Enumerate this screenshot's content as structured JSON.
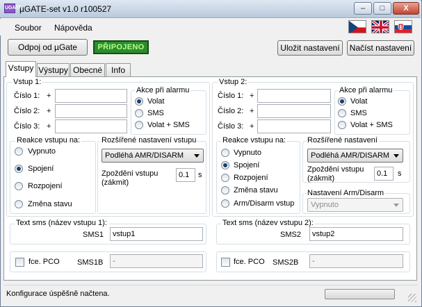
{
  "window": {
    "title": "µGATE-set v1.0 r100527",
    "min": "–",
    "max": "□",
    "close": "X",
    "app_icon": "UGATE"
  },
  "menu": [
    "Soubor",
    "Nápověda"
  ],
  "flags": [
    "cz-flag-icon",
    "uk-flag-icon",
    "sk-flag-icon"
  ],
  "toolbar": {
    "disconnect": "Odpoj od µGate",
    "status": "PŘIPOJENO",
    "save": "Uložit nastavení",
    "load": "Načíst nastavení"
  },
  "tabs": [
    "Vstupy",
    "Výstupy",
    "Obecné",
    "Info"
  ],
  "colors": {
    "status_bg": "#2c8c2c",
    "status_text": "#b6ff8c"
  },
  "input1": {
    "title": "Vstup 1:",
    "numbers": [
      {
        "label": "Číslo 1:",
        "plus": "+",
        "value": ""
      },
      {
        "label": "Číslo 2:",
        "plus": "+",
        "value": ""
      },
      {
        "label": "Číslo 3:",
        "plus": "+",
        "value": ""
      }
    ],
    "alarm": {
      "title": "Akce při alarmu",
      "options": [
        "Volat",
        "SMS",
        "Volat + SMS"
      ],
      "selected": 0
    },
    "reaction": {
      "title": "Reakce vstupu na:",
      "options": [
        "Vypnuto",
        "Spojení",
        "Rozpojení",
        "Změna stavu"
      ],
      "selected": 1
    },
    "extended": {
      "title": "Rozšířené nastavení vstupu",
      "mode": "Podléhá AMR/DISARM",
      "delay_label": "Zpoždění vstupu",
      "delay_sub": "(zákmit)",
      "delay_value": "0.1",
      "delay_unit": "s"
    },
    "sms": {
      "title": "Text sms (název vstupu 1):",
      "label": "SMS1",
      "value": "vstup1"
    },
    "pco": {
      "label": "fce. PCO",
      "checked": false,
      "sms_label": "SMS1B",
      "value": "-"
    }
  },
  "input2": {
    "title": "Vstup 2:",
    "numbers": [
      {
        "label": "Číslo 1:",
        "plus": "+",
        "value": ""
      },
      {
        "label": "Číslo 2:",
        "plus": "+",
        "value": ""
      },
      {
        "label": "Číslo 3:",
        "plus": "+",
        "value": ""
      }
    ],
    "alarm": {
      "title": "Akce při alarmu",
      "options": [
        "Volat",
        "SMS",
        "Volat + SMS"
      ],
      "selected": 0
    },
    "reaction": {
      "title": "Reakce vstupu na:",
      "options": [
        "Vypnuto",
        "Spojení",
        "Rozpojení",
        "Změna stavu",
        "Arm/Disarm vstup"
      ],
      "selected": 1
    },
    "extended": {
      "title": "Rozšířené nastavení",
      "mode": "Podléhá AMR/DISARM",
      "delay_label": "Zpoždění vstupu",
      "delay_sub": "(zákmit)",
      "delay_value": "0.1",
      "delay_unit": "s"
    },
    "armdisarm": {
      "title": "Nastavení Arm/Disarm",
      "value": "Vypnuto"
    },
    "sms": {
      "title": "Text sms (název vstupu 2):",
      "label": "SMS2",
      "value": "vstup2"
    },
    "pco": {
      "label": "fce. PCO",
      "checked": false,
      "sms_label": "SMS2B",
      "value": "-"
    }
  },
  "status": {
    "message": "Konfigurace úspěšně načtena."
  }
}
